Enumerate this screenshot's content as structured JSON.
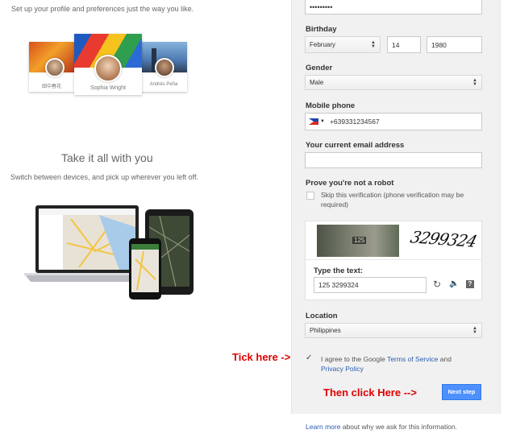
{
  "intro_text": "Set up your profile and preferences just the way you like.",
  "profiles": [
    {
      "name": "田中春花"
    },
    {
      "name": "Sophia Wright"
    },
    {
      "name": "Andrés Peña"
    }
  ],
  "take_title": "Take it all with you",
  "take_sub": "Switch between devices, and pick up wherever you left off.",
  "form": {
    "password_value": "•••••••••",
    "birthday_label": "Birthday",
    "birthday_month": "February",
    "birthday_day": "14",
    "birthday_year": "1980",
    "gender_label": "Gender",
    "gender_value": "Male",
    "mobile_label": "Mobile phone",
    "mobile_value": "+639331234567",
    "email_label": "Your current email address",
    "email_value": "",
    "robot_label": "Prove you're not a robot",
    "skip_text": "Skip this verification (phone verification may be required)",
    "captcha_text_image": "3299324",
    "captcha_house_number": "125",
    "type_text_label": "Type the text:",
    "captcha_value": "125 3299324",
    "location_label": "Location",
    "location_value": "Philippines",
    "agree_prefix": "I agree to the Google ",
    "terms_link": "Terms of Service",
    "agree_and": " and",
    "privacy_link": "Privacy Policy",
    "next_button": "Next step",
    "learn_more_link": "Learn more",
    "learn_more_rest": " about why we ask for this information."
  },
  "annotations": {
    "tick_here": "Tick here ->",
    "then_click": "Then click Here -->"
  },
  "colors": {
    "accent_blue": "#4d90fe",
    "annotation_red": "#e00000"
  }
}
